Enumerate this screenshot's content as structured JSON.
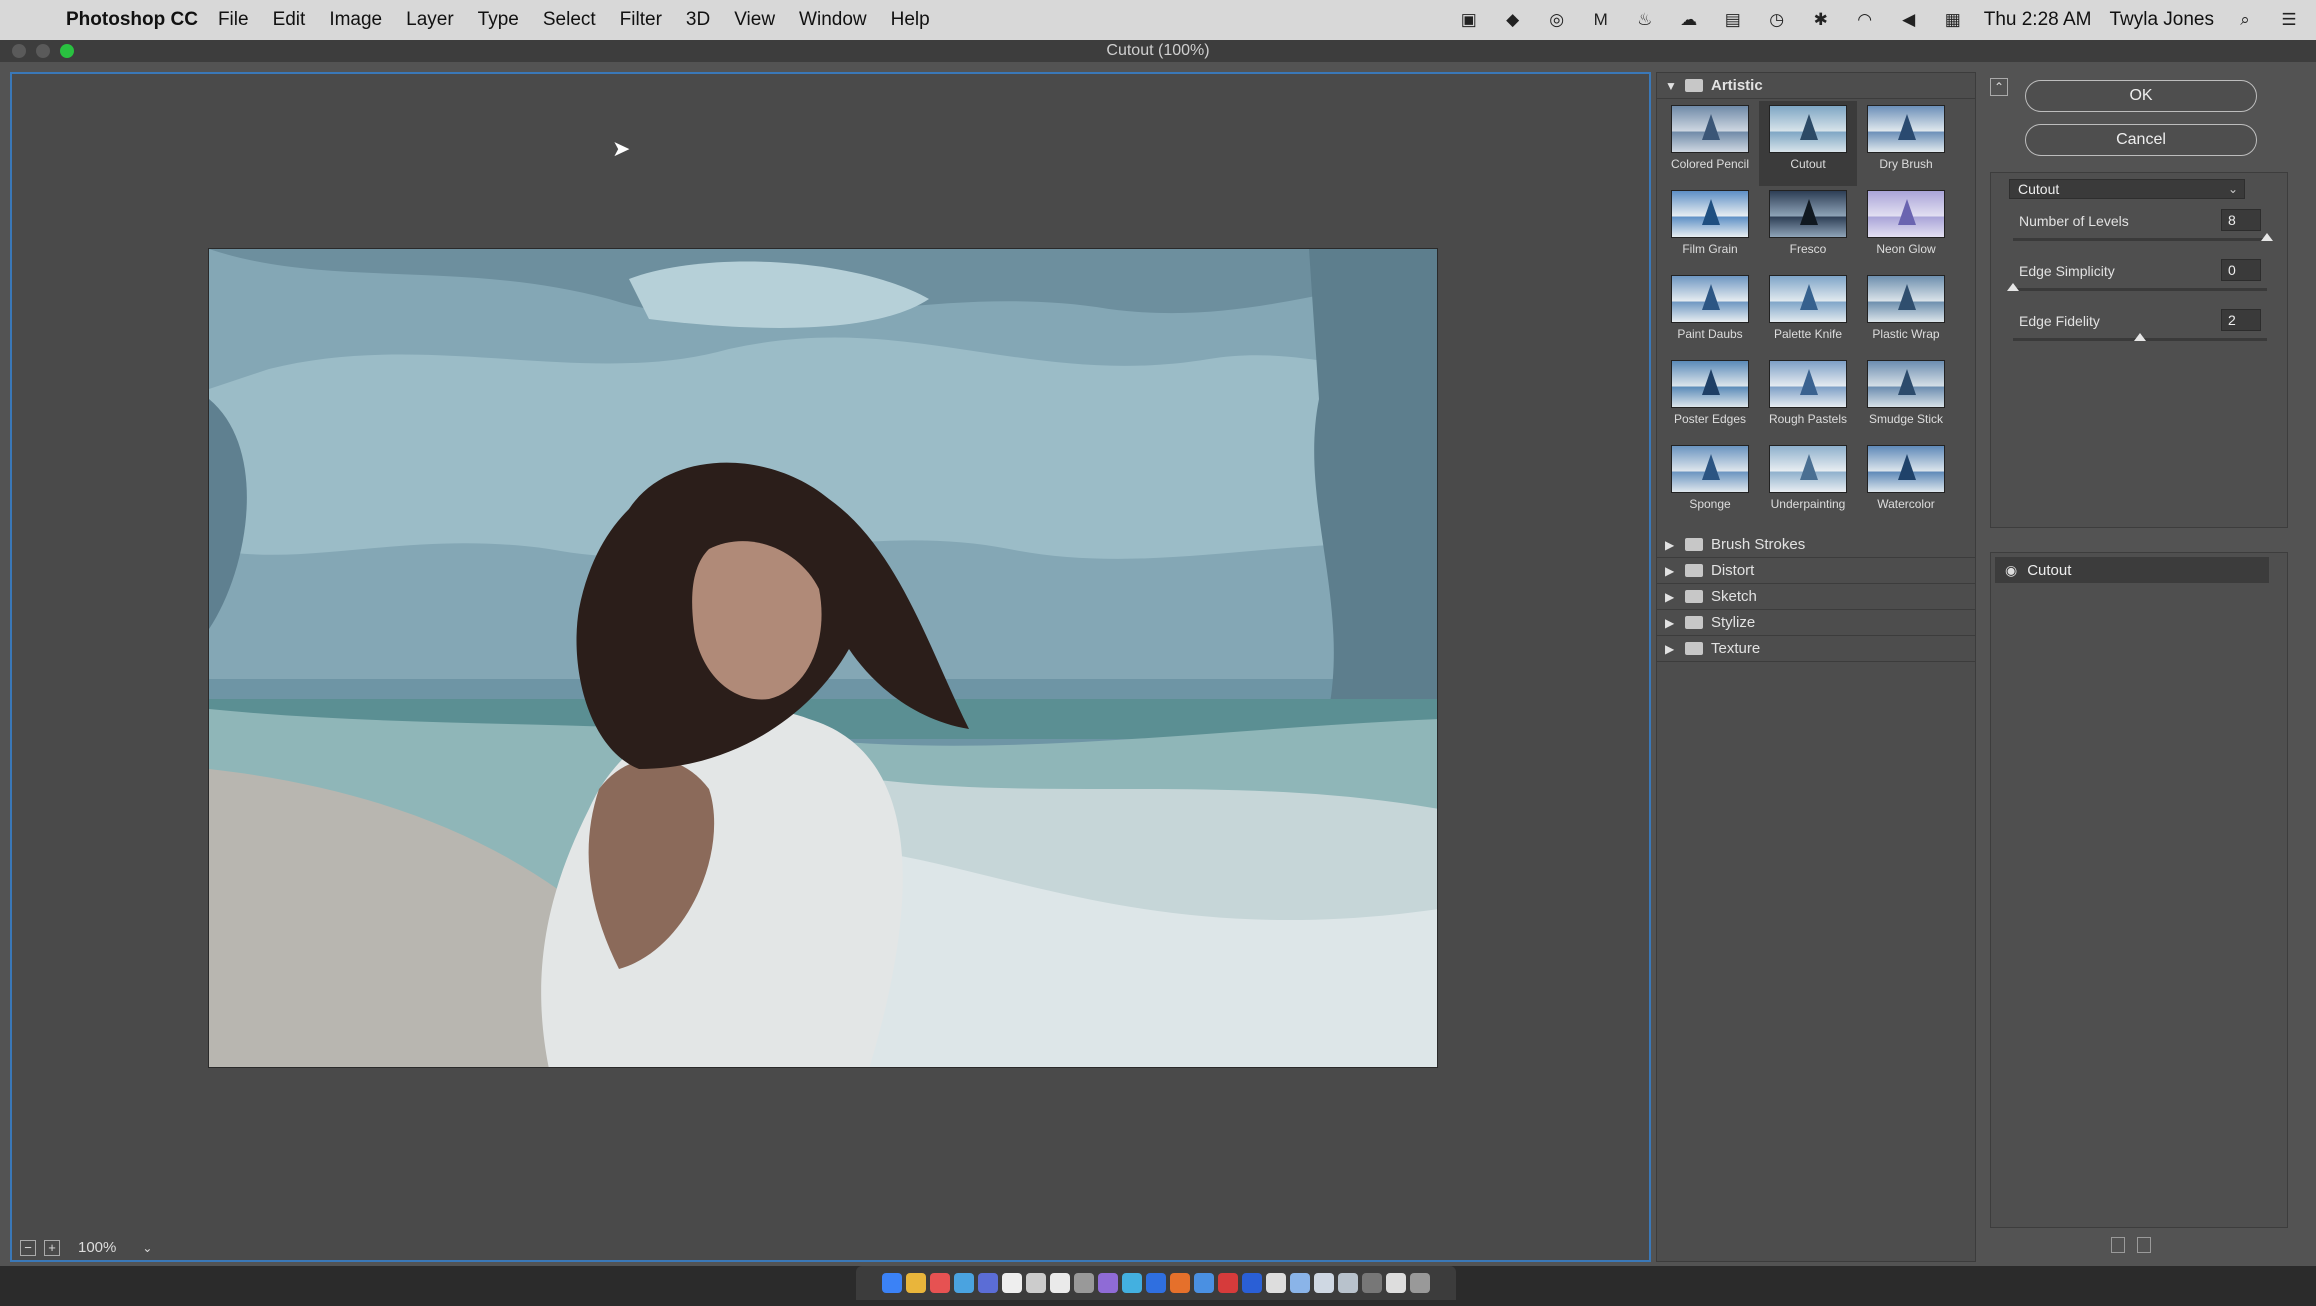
{
  "menubar": {
    "app_name": "Photoshop CC",
    "items": [
      "File",
      "Edit",
      "Image",
      "Layer",
      "Type",
      "Select",
      "Filter",
      "3D",
      "View",
      "Window",
      "Help"
    ],
    "clock": "Thu 2:28 AM",
    "user": "Twyla Jones"
  },
  "window": {
    "title": "Cutout (100%)"
  },
  "preview": {
    "zoom": "100%"
  },
  "filters": {
    "open_group": "Artistic",
    "thumbnails": [
      {
        "label": "Colored Pencil",
        "icon": "colored-pencil-thumb"
      },
      {
        "label": "Cutout",
        "icon": "cutout-thumb"
      },
      {
        "label": "Dry Brush",
        "icon": "dry-brush-thumb"
      },
      {
        "label": "Film Grain",
        "icon": "film-grain-thumb"
      },
      {
        "label": "Fresco",
        "icon": "fresco-thumb"
      },
      {
        "label": "Neon Glow",
        "icon": "neon-glow-thumb"
      },
      {
        "label": "Paint Daubs",
        "icon": "paint-daubs-thumb"
      },
      {
        "label": "Palette Knife",
        "icon": "palette-knife-thumb"
      },
      {
        "label": "Plastic Wrap",
        "icon": "plastic-wrap-thumb"
      },
      {
        "label": "Poster Edges",
        "icon": "poster-edges-thumb"
      },
      {
        "label": "Rough Pastels",
        "icon": "rough-pastels-thumb"
      },
      {
        "label": "Smudge Stick",
        "icon": "smudge-stick-thumb"
      },
      {
        "label": "Sponge",
        "icon": "sponge-thumb"
      },
      {
        "label": "Underpainting",
        "icon": "underpainting-thumb"
      },
      {
        "label": "Watercolor",
        "icon": "watercolor-thumb"
      }
    ],
    "selected": "Cutout",
    "closed_groups": [
      "Brush Strokes",
      "Distort",
      "Sketch",
      "Stylize",
      "Texture"
    ]
  },
  "settings": {
    "ok": "OK",
    "cancel": "Cancel",
    "filter_select": "Cutout",
    "params": [
      {
        "label": "Number of Levels",
        "value": "8",
        "fraction": 1.0
      },
      {
        "label": "Edge Simplicity",
        "value": "0",
        "fraction": 0.0
      },
      {
        "label": "Edge Fidelity",
        "value": "2",
        "fraction": 0.5
      }
    ]
  },
  "layers": {
    "active_layer": "Cutout"
  }
}
